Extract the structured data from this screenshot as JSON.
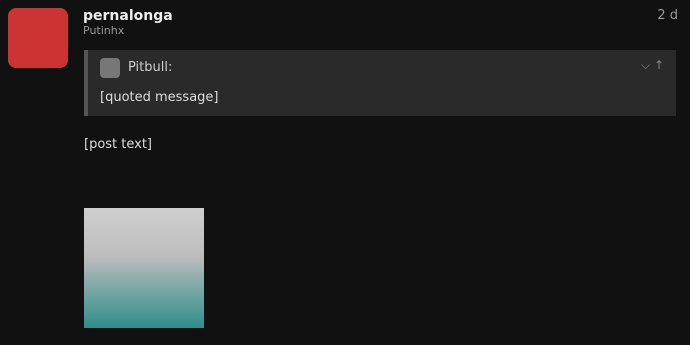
{
  "post": {
    "username": "pernalonga",
    "user_title": "Putinhx",
    "age": "2 d",
    "quote": {
      "author": "Pitbull:",
      "text": "[quoted message]"
    },
    "body": "[post text]"
  },
  "icons": {
    "avatar": "user-avatar-icon",
    "quote_expand": "chevron-down-icon",
    "quote_jump": "arrow-up-icon"
  }
}
